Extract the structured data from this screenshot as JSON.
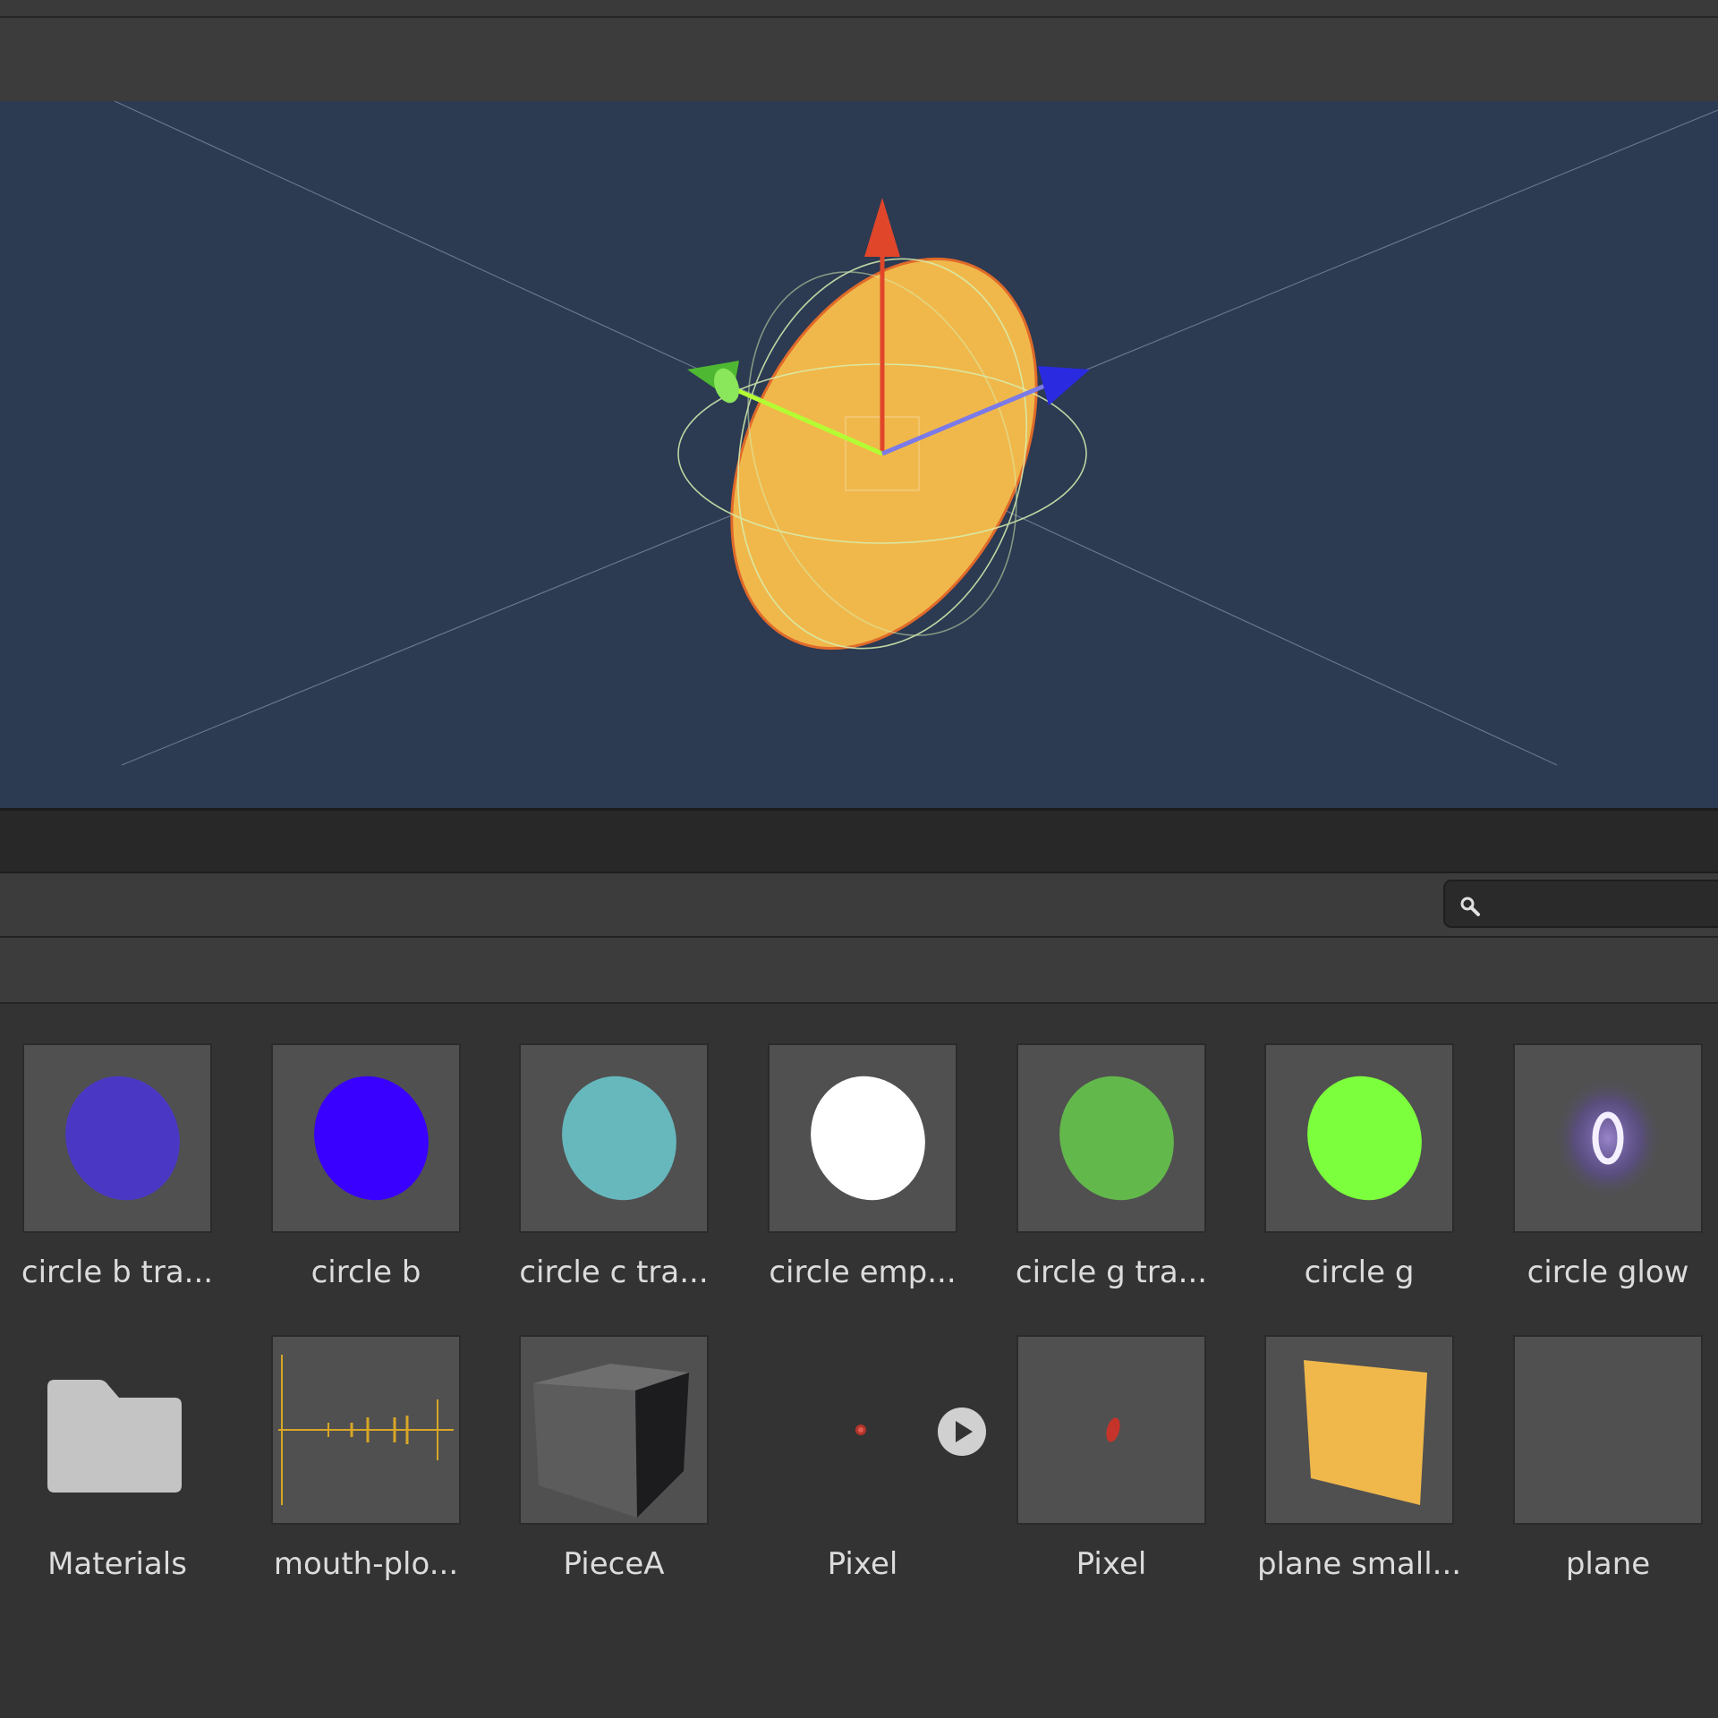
{
  "search": {
    "value": "",
    "placeholder": ""
  },
  "assets": [
    {
      "label": "circle b tra...",
      "icon": "blue-circle-transparent-sprite-icon",
      "color": "#4a38c4"
    },
    {
      "label": "circle b",
      "icon": "blue-circle-sprite-icon",
      "color": "#3a00ff"
    },
    {
      "label": "circle c tra...",
      "icon": "cyan-circle-transparent-sprite-icon",
      "color": "#67b8bd"
    },
    {
      "label": "circle emp...",
      "icon": "white-circle-sprite-icon",
      "color": "#ffffff"
    },
    {
      "label": "circle g tra...",
      "icon": "green-circle-transparent-sprite-icon",
      "color": "#63b84c"
    },
    {
      "label": "circle g",
      "icon": "green-circle-sprite-icon",
      "color": "#7cff3c"
    },
    {
      "label": "circle glow",
      "icon": "glow-ring-sprite-icon",
      "color": "#b89cff"
    },
    {
      "label": "Materials",
      "icon": "folder-icon",
      "color": "#c4c4c4"
    },
    {
      "label": "mouth-plo...",
      "icon": "audio-waveform-icon",
      "color": "#d9a626"
    },
    {
      "label": "PieceA",
      "icon": "cube-model-icon",
      "color": "#5c5c5c"
    },
    {
      "label": "Pixel",
      "icon": "pixel-prefab-icon",
      "color": "#b3342b"
    },
    {
      "label": "Pixel",
      "icon": "pixel-sprite-icon",
      "color": "#c4342b"
    },
    {
      "label": "plane small...",
      "icon": "orange-plane-icon",
      "color": "#f0b84b"
    },
    {
      "label": "plane",
      "icon": "plane-blank-icon",
      "color": "#505050"
    }
  ],
  "viewport": {
    "background": "#2c3a52",
    "selected_object_color": "#f0b84b",
    "axis_colors": {
      "y": "#e0462a",
      "x": "#b3ff33",
      "z": "#3535e6"
    }
  }
}
